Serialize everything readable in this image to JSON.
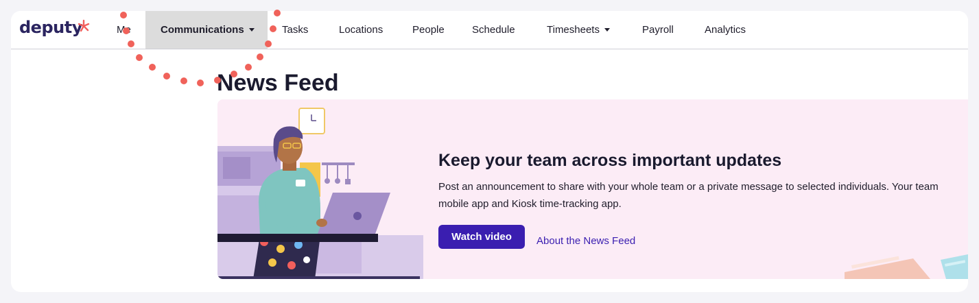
{
  "brand": {
    "logo_text": "deputy",
    "accent_color": "#f25f5c",
    "brand_color": "#2b2560"
  },
  "nav": {
    "items": [
      {
        "label": "Me"
      },
      {
        "label": "Communications",
        "dropdown": true,
        "active": true
      },
      {
        "label": "Tasks"
      },
      {
        "label": "Locations"
      },
      {
        "label": "People"
      },
      {
        "label": "Schedule"
      },
      {
        "label": "Timesheets",
        "dropdown": true
      },
      {
        "label": "Payroll"
      },
      {
        "label": "Analytics"
      }
    ]
  },
  "page": {
    "title": "News Feed"
  },
  "banner": {
    "heading": "Keep your team across important updates",
    "desc_line1": "Post an announcement to share with your whole team or a private message to selected individuals. Your team",
    "desc_line2": "mobile app and Kiosk time-tracking app.",
    "watch_label": "Watch video",
    "about_label": "About the News Feed",
    "button_color": "#3a1eb0",
    "background_color": "#fcecf6"
  }
}
